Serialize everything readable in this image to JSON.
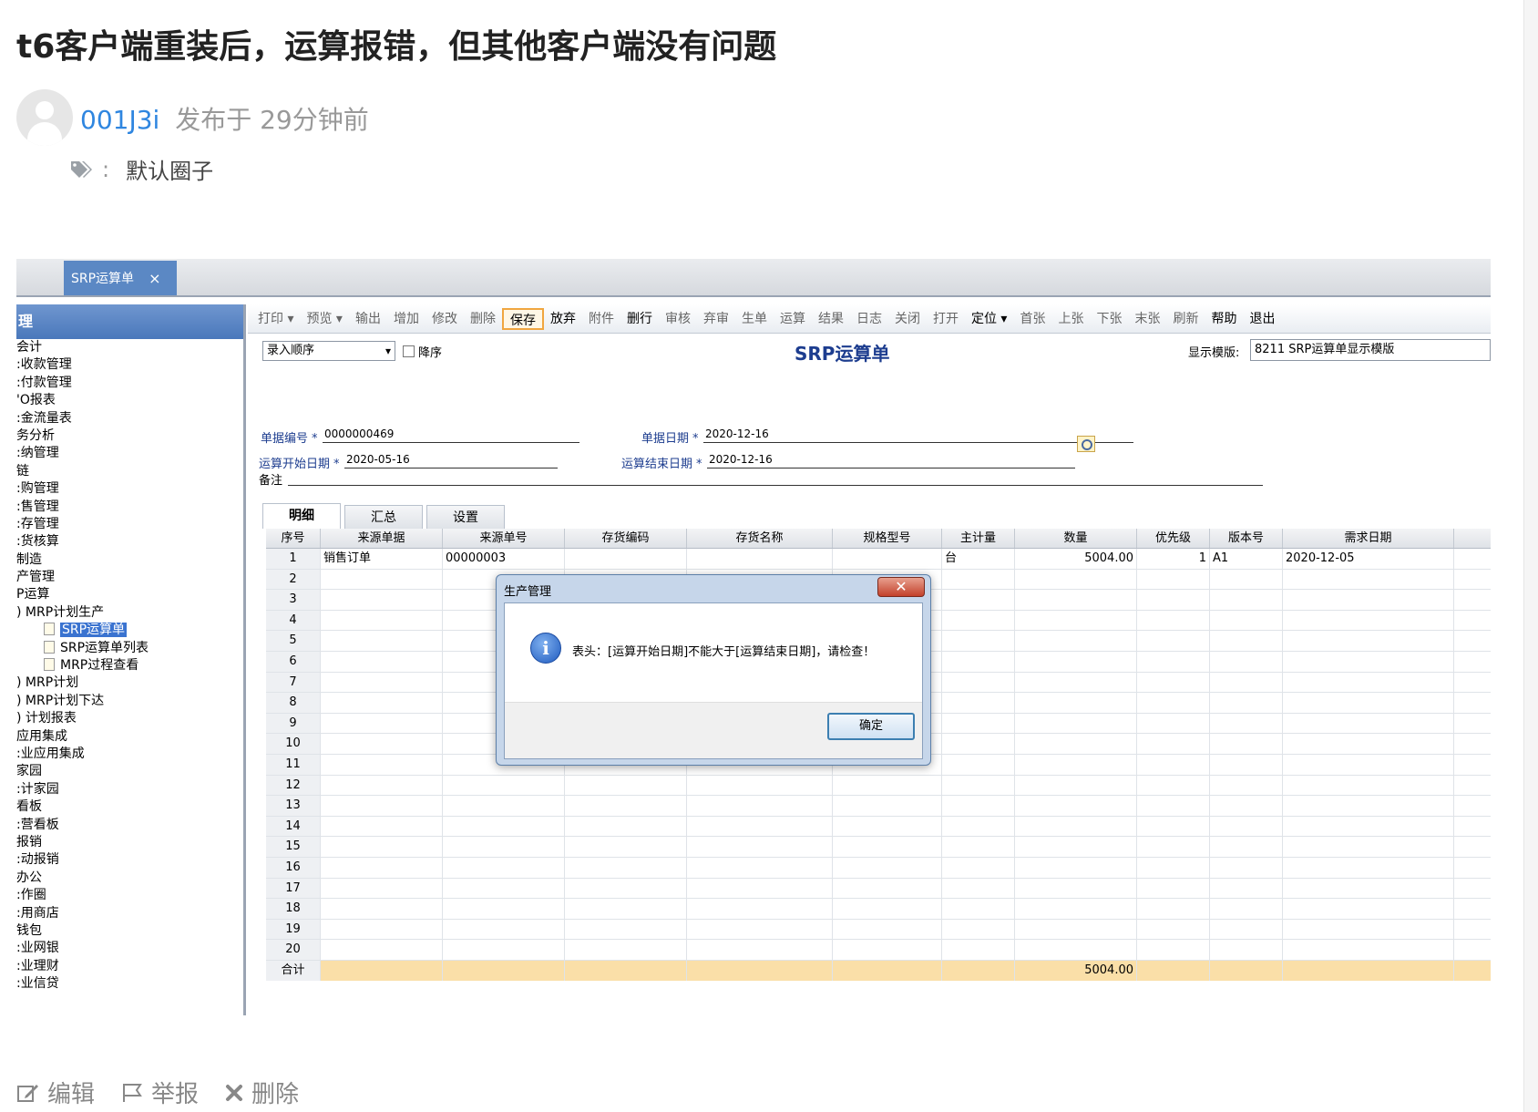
{
  "post": {
    "title": "t6客户端重装后，运算报错，但其他客户端没有问题",
    "author": "001J3i",
    "posted": "发布于 29分钟前",
    "tag_colon": ":",
    "tag": "默认圈子"
  },
  "app": {
    "tab_label": "SRP运算单",
    "tab_close": "×",
    "sidebar_header": "理",
    "sidebar_items": [
      {
        "label": "会计",
        "child": false
      },
      {
        "label": ":收款管理",
        "child": false
      },
      {
        "label": ":付款管理",
        "child": false
      },
      {
        "label": "'O报表",
        "child": false
      },
      {
        "label": ":金流量表",
        "child": false
      },
      {
        "label": "务分析",
        "child": false
      },
      {
        "label": ":纳管理",
        "child": false
      },
      {
        "label": "链",
        "child": false
      },
      {
        "label": ":购管理",
        "child": false
      },
      {
        "label": ":售管理",
        "child": false
      },
      {
        "label": ":存管理",
        "child": false
      },
      {
        "label": ":货核算",
        "child": false
      },
      {
        "label": "制造",
        "child": false
      },
      {
        "label": "产管理",
        "child": false
      },
      {
        "label": "P运算",
        "child": false
      },
      {
        "label": ") MRP计划生产",
        "child": false
      },
      {
        "label": "SRP运算单",
        "child": true,
        "selected": true
      },
      {
        "label": "SRP运算单列表",
        "child": true
      },
      {
        "label": "MRP过程查看",
        "child": true
      },
      {
        "label": ") MRP计划",
        "child": false
      },
      {
        "label": ") MRP计划下达",
        "child": false
      },
      {
        "label": ") 计划报表",
        "child": false
      },
      {
        "label": "应用集成",
        "child": false
      },
      {
        "label": ":业应用集成",
        "child": false
      },
      {
        "label": "家园",
        "child": false
      },
      {
        "label": ":计家园",
        "child": false
      },
      {
        "label": "看板",
        "child": false
      },
      {
        "label": ":营看板",
        "child": false
      },
      {
        "label": "报销",
        "child": false
      },
      {
        "label": ":动报销",
        "child": false
      },
      {
        "label": "办公",
        "child": false
      },
      {
        "label": ":作圈",
        "child": false
      },
      {
        "label": ":用商店",
        "child": false
      },
      {
        "label": "钱包",
        "child": false
      },
      {
        "label": ":业网银",
        "child": false
      },
      {
        "label": ":业理财",
        "child": false
      },
      {
        "label": ":业信贷",
        "child": false
      }
    ],
    "toolbar": [
      "打印 ▾",
      "预览 ▾",
      "输出",
      "增加",
      "修改",
      "删除",
      "保存",
      "放弃",
      "附件",
      "删行",
      "审核",
      "弃审",
      "生单",
      "运算",
      "结果",
      "日志",
      "关闭",
      "打开",
      "定位 ▾",
      "首张",
      "上张",
      "下张",
      "末张",
      "刷新",
      "帮助",
      "退出"
    ],
    "toolbar_active": [
      "保存",
      "放弃",
      "删行",
      "定位 ▾",
      "帮助",
      "退出"
    ],
    "order_select": "录入顺序",
    "desc_label": "降序",
    "doc_title": "SRP运算单",
    "template_label": "显示模版:",
    "template_value": "8211 SRP运算单显示模版",
    "fields": {
      "doc_no_label": "单据编号",
      "doc_no": "0000000469",
      "doc_date_label": "单据日期",
      "doc_date": "2020-12-16",
      "start_label": "运算开始日期",
      "start_date": "2020-05-16",
      "end_label": "运算结束日期",
      "end_date": "2020-12-16",
      "note_label": "备注",
      "required_mark": "*"
    },
    "detail_tabs": [
      "明细",
      "汇总",
      "设置"
    ],
    "grid": {
      "headers": [
        "序号",
        "来源单据",
        "来源单号",
        "存货编码",
        "存货名称",
        "规格型号",
        "主计量",
        "数量",
        "优先级",
        "版本号",
        "需求日期"
      ],
      "first_row": [
        "1",
        "销售订单",
        "00000003",
        "",
        "",
        "",
        "台",
        "5004.00",
        "1",
        "A1",
        "2020-12-05"
      ],
      "row_numbers": [
        "2",
        "3",
        "4",
        "5",
        "6",
        "7",
        "8",
        "9",
        "10",
        "11",
        "12",
        "13",
        "14",
        "15",
        "16",
        "17",
        "18",
        "19",
        "20"
      ],
      "total_label": "合计",
      "total_qty": "5004.00"
    },
    "dialog": {
      "title": "生产管理",
      "close": "✕",
      "info_glyph": "i",
      "message": "表头：[运算开始日期]不能大于[运算结束日期]，请检查！",
      "ok": "确定"
    }
  },
  "actions": {
    "edit": "编辑",
    "report": "举报",
    "delete": "删除"
  }
}
